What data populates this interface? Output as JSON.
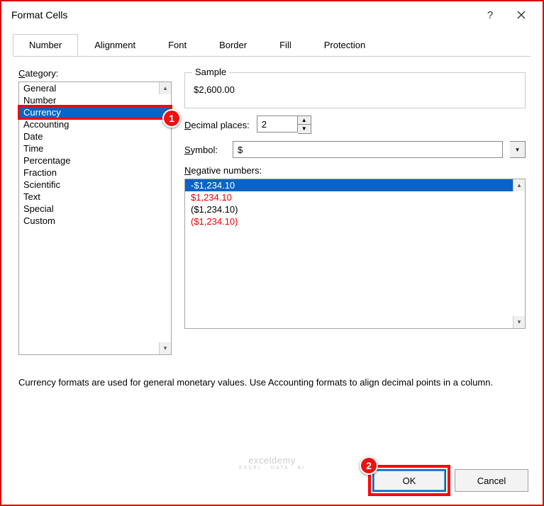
{
  "title": "Format Cells",
  "tabs": [
    "Number",
    "Alignment",
    "Font",
    "Border",
    "Fill",
    "Protection"
  ],
  "active_tab": "Number",
  "category_label": "Category:",
  "category_underline": "C",
  "categories": [
    "General",
    "Number",
    "Currency",
    "Accounting",
    "Date",
    "Time",
    "Percentage",
    "Fraction",
    "Scientific",
    "Text",
    "Special",
    "Custom"
  ],
  "selected_category": "Currency",
  "sample_label": "Sample",
  "sample_value": "$2,600.00",
  "decimal_label": "Decimal places:",
  "decimal_underline": "D",
  "decimal_value": "2",
  "symbol_label": "Symbol:",
  "symbol_underline": "S",
  "symbol_value": "$",
  "negative_label": "Negative numbers:",
  "negative_underline": "N",
  "negative_items": [
    {
      "text": "-$1,234.10",
      "red": false,
      "selected": true
    },
    {
      "text": "$1,234.10",
      "red": true,
      "selected": false
    },
    {
      "text": "($1,234.10)",
      "red": false,
      "selected": false
    },
    {
      "text": "($1,234.10)",
      "red": true,
      "selected": false
    }
  ],
  "description": "Currency formats are used for general monetary values.  Use Accounting formats to align decimal points in a column.",
  "ok_label": "OK",
  "cancel_label": "Cancel",
  "callouts": {
    "one": "1",
    "two": "2"
  },
  "watermark": {
    "main": "exceldemy",
    "sub": "EXCEL · DATA · BI"
  }
}
